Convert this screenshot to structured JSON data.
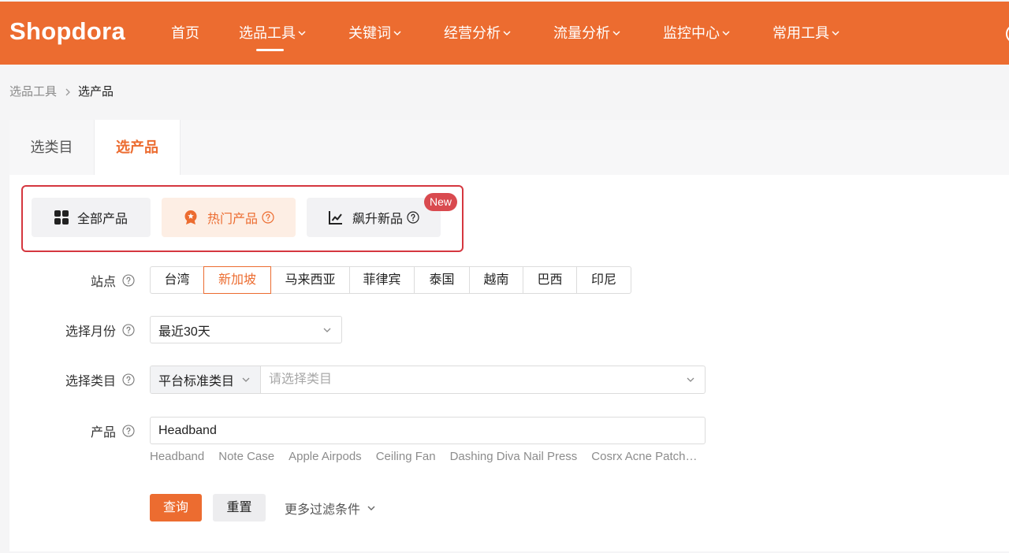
{
  "header": {
    "logo": "Shopdora",
    "nav": [
      {
        "label": "首页",
        "active": false
      },
      {
        "label": "选品工具",
        "active": true
      },
      {
        "label": "关键词",
        "active": false
      },
      {
        "label": "经营分析",
        "active": false
      },
      {
        "label": "流量分析",
        "active": false
      },
      {
        "label": "监控中心",
        "active": false
      },
      {
        "label": "常用工具",
        "active": false
      }
    ]
  },
  "breadcrumb": [
    {
      "label": "选品工具",
      "current": false
    },
    {
      "label": "选产品",
      "current": true
    }
  ],
  "tabs": [
    {
      "label": "选类目",
      "active": false
    },
    {
      "label": "选产品",
      "active": true
    }
  ],
  "product_types": [
    {
      "label": "全部产品",
      "icon": "grid-icon",
      "active": false
    },
    {
      "label": "热门产品",
      "icon": "medal-icon",
      "active": true
    },
    {
      "label": "飙升新品",
      "icon": "trend-chart-icon",
      "active": false,
      "badge": "New"
    }
  ],
  "form": {
    "site": {
      "label": "站点",
      "options": [
        {
          "label": "台湾",
          "selected": false
        },
        {
          "label": "新加坡",
          "selected": true
        },
        {
          "label": "马来西亚",
          "selected": false
        },
        {
          "label": "菲律宾",
          "selected": false
        },
        {
          "label": "泰国",
          "selected": false
        },
        {
          "label": "越南",
          "selected": false
        },
        {
          "label": "巴西",
          "selected": false
        },
        {
          "label": "印尼",
          "selected": false
        }
      ]
    },
    "month": {
      "label": "选择月份",
      "value": "最近30天"
    },
    "category": {
      "label": "选择类目",
      "source": "平台标准类目",
      "placeholder": "请选择类目"
    },
    "product": {
      "label": "产品",
      "value": "Headband",
      "suggestions": [
        "Headband",
        "Note Case",
        "Apple Airpods",
        "Ceiling Fan",
        "Dashing Diva Nail Press",
        "Cosrx Acne Patch…"
      ]
    }
  },
  "actions": {
    "search": "查询",
    "reset": "重置",
    "more_filters": "更多过滤条件"
  },
  "colors": {
    "brand": "#EC6C30",
    "brand_tint": "#FDEEE4",
    "annotation_box": "#D5373F",
    "badge": "#D94A4F"
  }
}
